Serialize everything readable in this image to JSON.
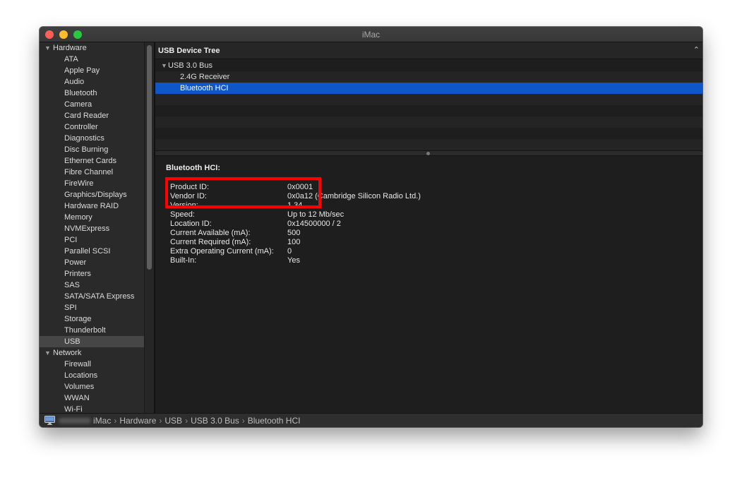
{
  "window": {
    "title": "iMac"
  },
  "sidebar": {
    "groups": [
      {
        "label": "Hardware",
        "items": [
          "ATA",
          "Apple Pay",
          "Audio",
          "Bluetooth",
          "Camera",
          "Card Reader",
          "Controller",
          "Diagnostics",
          "Disc Burning",
          "Ethernet Cards",
          "Fibre Channel",
          "FireWire",
          "Graphics/Displays",
          "Hardware RAID",
          "Memory",
          "NVMExpress",
          "PCI",
          "Parallel SCSI",
          "Power",
          "Printers",
          "SAS",
          "SATA/SATA Express",
          "SPI",
          "Storage",
          "Thunderbolt",
          "USB"
        ]
      },
      {
        "label": "Network",
        "items": [
          "Firewall",
          "Locations",
          "Volumes",
          "WWAN",
          "Wi-Fi"
        ]
      }
    ],
    "selected": "USB"
  },
  "device_tree": {
    "title": "USB Device Tree",
    "bus": "USB 3.0 Bus",
    "devices": [
      "2.4G Receiver",
      "Bluetooth HCI"
    ],
    "selected": "Bluetooth HCI"
  },
  "detail": {
    "title": "Bluetooth HCI:",
    "properties": [
      {
        "key": "Product ID:",
        "value": "0x0001"
      },
      {
        "key": "Vendor ID:",
        "value": "0x0a12  (Cambridge Silicon Radio Ltd.)"
      },
      {
        "key": "Version:",
        "value": "1.34"
      },
      {
        "key": "Speed:",
        "value": "Up to 12 Mb/sec"
      },
      {
        "key": "Location ID:",
        "value": "0x14500000 / 2"
      },
      {
        "key": "Current Available (mA):",
        "value": "500"
      },
      {
        "key": "Current Required (mA):",
        "value": "100"
      },
      {
        "key": "Extra Operating Current (mA):",
        "value": "0"
      },
      {
        "key": "Built-In:",
        "value": "Yes"
      }
    ]
  },
  "statusbar": {
    "breadcrumbs": [
      "iMac",
      "Hardware",
      "USB",
      "USB 3.0 Bus",
      "Bluetooth HCI"
    ]
  },
  "colors": {
    "selection": "#0f56c9",
    "highlight_box": "#ff0000",
    "background": "#1e1e1e"
  },
  "icons": [
    "disclosure-triangle-icon",
    "chevron-up-icon",
    "imac-icon"
  ]
}
